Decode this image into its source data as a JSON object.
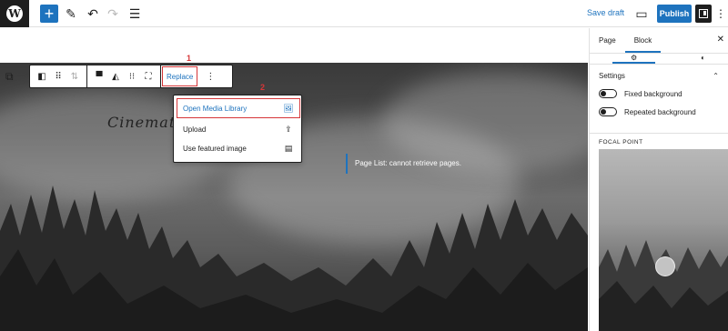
{
  "topbar": {
    "logo_letter": "W",
    "add_icon": "plus-icon",
    "tools_icon": "pencil-icon",
    "undo_icon": "undo-icon",
    "redo_icon": "redo-icon",
    "list_view_icon": "list-view-icon",
    "save_draft": "Save draft",
    "preview_icon": "desktop-preview-icon",
    "publish": "Publish",
    "settings_icon": "sidebar-toggle-icon",
    "more_icon": "vertical-ellipsis-icon"
  },
  "block_toolbar": {
    "replace": "Replace",
    "more_icon": "vertical-ellipsis-icon"
  },
  "annotations": {
    "step1": "1",
    "step2": "2"
  },
  "replace_menu": {
    "items": [
      {
        "label": "Open Media Library",
        "icon": "media-library-icon",
        "active": true
      },
      {
        "label": "Upload",
        "icon": "upload-icon",
        "active": false
      },
      {
        "label": "Use featured image",
        "icon": "featured-image-icon",
        "active": false
      }
    ]
  },
  "canvas": {
    "site_title_cursive": "Cinemat",
    "page_list_message": "Page List: cannot retrieve pages."
  },
  "sidebar": {
    "tabs": [
      "Page",
      "Block"
    ],
    "active_tab": "Block",
    "settings_heading": "Settings",
    "toggles": [
      {
        "label": "Fixed background",
        "on": false
      },
      {
        "label": "Repeated background",
        "on": false
      }
    ],
    "focal_point_label": "FOCAL POINT"
  },
  "colors": {
    "accent": "#1e73be",
    "annotation": "#d63638",
    "dark": "#1e1e1e"
  }
}
